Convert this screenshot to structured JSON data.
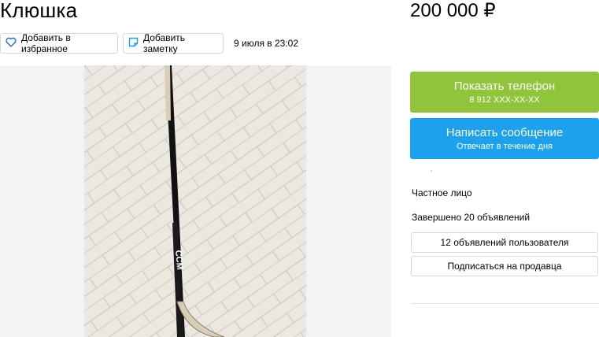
{
  "listing": {
    "title": "Клюшка",
    "price": "200 000 ₽",
    "date": "9 июля в 23:02"
  },
  "actions": {
    "favorite_label": "Добавить в избранное",
    "note_label": "Добавить заметку"
  },
  "contact": {
    "phone_button": "Показать телефон",
    "phone_masked": "8 912 XXX-XX-XX",
    "message_button": "Написать сообщение",
    "message_sub": "Отвечает в течение дня"
  },
  "seller": {
    "type": "Частное лицо",
    "completed": "Завершено 20 объявлений",
    "ads_button": "12 объявлений пользователя",
    "subscribe_button": "Подписаться на продавца"
  },
  "photo": {
    "stick_brand": "CCM",
    "colors": {
      "floor": "#e9e5df",
      "shaft": "#1a1a1a",
      "blade": "#d8cdb6"
    }
  },
  "colors": {
    "phone_button": "#8fc43b",
    "message_button": "#1ba1ee",
    "favorite_icon": "#1a6fd6",
    "note_icon": "#1ba1ee"
  },
  "icons": {
    "favorite": "heart-icon",
    "note": "note-icon"
  }
}
